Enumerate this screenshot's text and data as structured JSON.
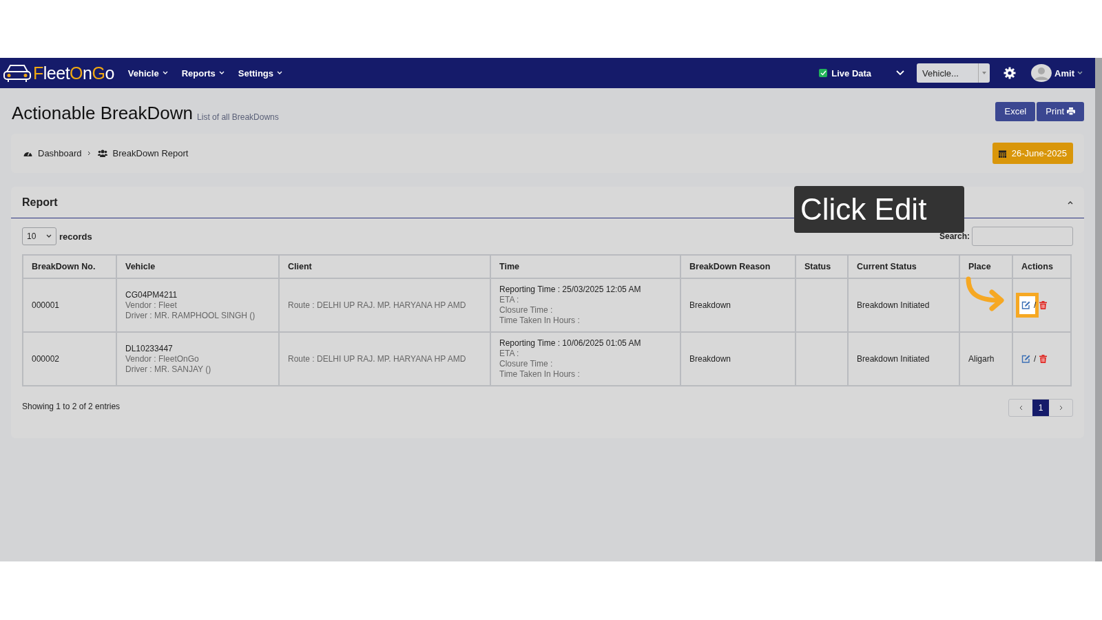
{
  "nav": {
    "logo": [
      {
        "text": "F",
        "accent": true
      },
      {
        "text": "leet",
        "accent": false
      },
      {
        "text": "O",
        "accent": true
      },
      {
        "text": "n",
        "accent": false
      },
      {
        "text": "G",
        "accent": true
      },
      {
        "text": "o",
        "accent": false
      }
    ],
    "menus": [
      "Vehicle",
      "Reports",
      "Settings"
    ],
    "live_data": {
      "label": "Live Data",
      "checked": true
    },
    "vehicle_select": {
      "value": "Vehicle..."
    },
    "user": "Amit"
  },
  "header": {
    "title": "Actionable BreakDown",
    "subtitle": "List of all BreakDowns",
    "buttons": [
      {
        "label": "Excel",
        "kind": "plain"
      },
      {
        "label": "Print",
        "kind": "print"
      }
    ]
  },
  "breadcrumb": {
    "items": [
      {
        "label": "Dashboard",
        "kind": "dashboard"
      },
      {
        "label": "BreakDown Report",
        "kind": "users"
      }
    ],
    "date": "26-June-2025"
  },
  "report": {
    "title": "Report",
    "expanded": true,
    "page_length": "10",
    "records_label": "records",
    "search_label": "Search:",
    "columns": [
      "BreakDown No.",
      "Vehicle",
      "Client",
      "Time",
      "BreakDown Reason",
      "Status",
      "Current Status",
      "Place",
      "Actions"
    ],
    "rows": [
      {
        "number": "000001",
        "plate": "CG04PM4211",
        "vendor": "Vendor :  Fleet",
        "driver": "Driver :  MR. RAMPHOOL SINGH ()",
        "client": "Route :  DELHI UP RAJ. MP. HARYANA HP AMD",
        "time": [
          "Reporting Time :  25/03/2025 12:05 AM",
          "ETA :",
          "Closure Time :",
          "Time Taken In Hours :"
        ],
        "reason": "Breakdown",
        "current_status": "Breakdown Initiated",
        "separator": "/",
        "highlighted": true
      },
      {
        "number": "000002",
        "plate": "DL10233447",
        "vendor": "Vendor :  FleetOnGo",
        "driver": "Driver :  MR. SANJAY ()",
        "client": "Route :  DELHI UP RAJ. MP. HARYANA HP AMD",
        "time": [
          "Reporting Time :  10/06/2025 01:05 AM",
          "ETA :",
          "Closure Time :",
          "Time Taken In Hours :"
        ],
        "reason": "Breakdown",
        "current_status": "Breakdown Initiated",
        "place": "Aligarh",
        "separator": "/",
        "highlighted": false
      }
    ],
    "info": "Showing 1 to 2 of 2 entries",
    "pages": [
      {
        "label": "1",
        "selected": true
      }
    ]
  },
  "callout": {
    "text": "Click Edit"
  }
}
